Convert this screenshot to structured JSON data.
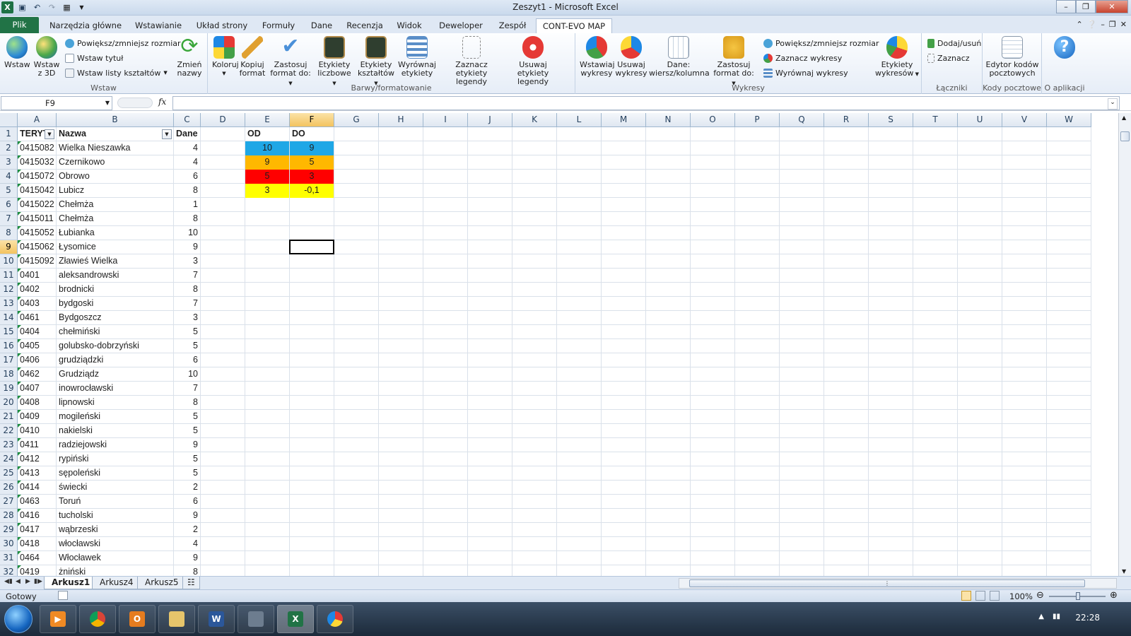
{
  "window": {
    "title": "Zeszyt1  -  Microsoft Excel"
  },
  "tabs": [
    "Plik",
    "Narzędzia główne",
    "Wstawianie",
    "Układ strony",
    "Formuły",
    "Dane",
    "Recenzja",
    "Widok",
    "Deweloper",
    "Zespół",
    "CONT-EVO MAP"
  ],
  "ribbon": {
    "wstaw": {
      "btn1": "Wstaw",
      "btn2a": "Wstaw",
      "btn2b": "z 3D",
      "s1": "Powiększ/zmniejsz rozmiar",
      "s2": "Wstaw tytuł",
      "s3": "Wstaw listy kształtów",
      "btn3a": "Zmień",
      "btn3b": "nazwy",
      "label": "Wstaw"
    },
    "barwy": {
      "b1a": "Koloruj",
      "b2a": "Kopiuj",
      "b2b": "format",
      "b3a": "Zastosuj",
      "b3b": "format do:",
      "b4a": "Etykiety",
      "b4b": "liczbowe",
      "b5a": "Etykiety",
      "b5b": "kształtów",
      "b6a": "Wyrównaj",
      "b6b": "etykiety",
      "b7a": "Zaznacz etykiety",
      "b7b": "legendy",
      "b8a": "Usuwaj etykiety",
      "b8b": "legendy",
      "label": "Barwy/formatowanie"
    },
    "wykresy": {
      "b1a": "Wstawiaj",
      "b1b": "wykresy",
      "b2a": "Usuwaj",
      "b2b": "wykresy",
      "b3a": "Dane:",
      "b3b": "wiersz/kolumna",
      "b4a": "Zastosuj",
      "b4b": "format do:",
      "s1": "Powiększ/zmniejsz rozmiar",
      "s2": "Zaznacz wykresy",
      "s3": "Wyrównaj wykresy",
      "b5a": "Etykiety",
      "b5b": "wykresów",
      "label": "Wykresy"
    },
    "laczniki": {
      "s1": "Dodaj/usuń",
      "s2": "Zaznacz",
      "label": "Łączniki"
    },
    "kody": {
      "b1a": "Edytor kodów",
      "b1b": "pocztowych",
      "label": "Kody pocztowe"
    },
    "about": {
      "label": "O aplikacji"
    }
  },
  "namebox": "F9",
  "fx": "fx",
  "columns": [
    "A",
    "B",
    "C",
    "D",
    "E",
    "F",
    "G",
    "H",
    "I",
    "J",
    "K",
    "L",
    "M",
    "N",
    "O",
    "P",
    "Q",
    "R",
    "S",
    "T",
    "U",
    "V",
    "W"
  ],
  "headers": {
    "a": "TERYT",
    "b": "Nazwa",
    "c": "Dane",
    "e": "OD",
    "f": "DO"
  },
  "rows": [
    [
      "0415082",
      "Wielka Nieszawka",
      "4"
    ],
    [
      "0415032",
      "Czernikowo",
      "4"
    ],
    [
      "0415072",
      "Obrowo",
      "6"
    ],
    [
      "0415042",
      "Lubicz",
      "8"
    ],
    [
      "0415022",
      "Chełmża",
      "1"
    ],
    [
      "0415011",
      "Chełmża",
      "8"
    ],
    [
      "0415052",
      "Łubianka",
      "10"
    ],
    [
      "0415062",
      "Łysomice",
      "9"
    ],
    [
      "0415092",
      "Zławieś Wielka",
      "3"
    ],
    [
      "0401",
      "aleksandrowski",
      "7"
    ],
    [
      "0402",
      "brodnicki",
      "8"
    ],
    [
      "0403",
      "bydgoski",
      "7"
    ],
    [
      "0461",
      "Bydgoszcz",
      "3"
    ],
    [
      "0404",
      "chełmiński",
      "5"
    ],
    [
      "0405",
      "golubsko-dobrzyński",
      "5"
    ],
    [
      "0406",
      "grudziądzki",
      "6"
    ],
    [
      "0462",
      "Grudziądz",
      "10"
    ],
    [
      "0407",
      "inowrocławski",
      "7"
    ],
    [
      "0408",
      "lipnowski",
      "8"
    ],
    [
      "0409",
      "mogileński",
      "5"
    ],
    [
      "0410",
      "nakielski",
      "5"
    ],
    [
      "0411",
      "radziejowski",
      "9"
    ],
    [
      "0412",
      "rypiński",
      "5"
    ],
    [
      "0413",
      "sępoleński",
      "5"
    ],
    [
      "0414",
      "świecki",
      "2"
    ],
    [
      "0463",
      "Toruń",
      "6"
    ],
    [
      "0416",
      "tucholski",
      "9"
    ],
    [
      "0417",
      "wąbrzeski",
      "2"
    ],
    [
      "0418",
      "włocławski",
      "4"
    ],
    [
      "0464",
      "Włocławek",
      "9"
    ],
    [
      "0419",
      "żniński",
      "8"
    ]
  ],
  "ranges": [
    {
      "od": "10",
      "do": "9",
      "color": "#1ea7e6"
    },
    {
      "od": "9",
      "do": "5",
      "color": "#ffb800"
    },
    {
      "od": "5",
      "do": "3",
      "color": "#ff0000"
    },
    {
      "od": "3",
      "do": "-0,1",
      "color": "#ffff00"
    }
  ],
  "sheets": [
    "Arkusz1",
    "Arkusz4",
    "Arkusz5"
  ],
  "status": {
    "ready": "Gotowy",
    "zoom": "100%"
  },
  "clock": "22:28",
  "colors": {
    "accent": "#217346",
    "selection": "#f3c35f"
  }
}
